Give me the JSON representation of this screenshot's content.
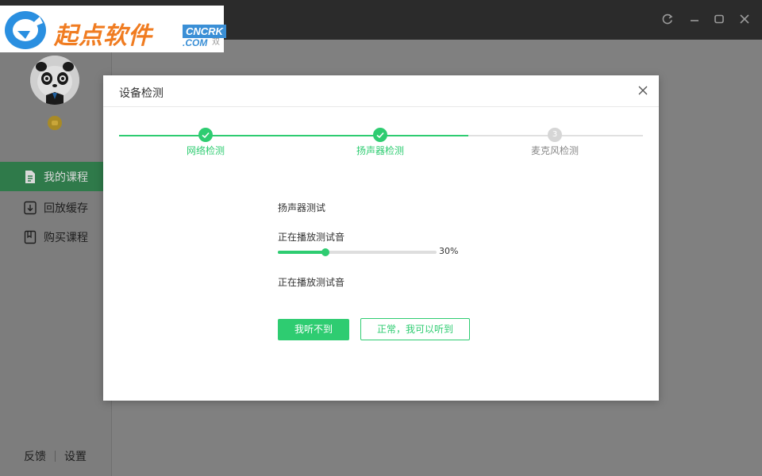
{
  "colors": {
    "accent": "#2ecc71",
    "titlebar": "#2b2b2b",
    "overlay": "#808080",
    "logo_orange": "#f07c21",
    "logo_blue": "#3a8fd6"
  },
  "logo": {
    "text": "起点软件",
    "badge_top": "CNCRK",
    "badge_bottom": ".COM",
    "badge_ext": "双"
  },
  "window_controls": {
    "refresh": "refresh-icon",
    "minimize": "minimize-icon",
    "maximize": "maximize-icon",
    "close": "close-icon"
  },
  "sidebar": {
    "items": [
      {
        "label": "我的课程",
        "icon": "document-icon",
        "active": true
      },
      {
        "label": "回放缓存",
        "icon": "download-icon",
        "active": false
      },
      {
        "label": "购买课程",
        "icon": "book-icon",
        "active": false
      }
    ],
    "footer": {
      "feedback": "反馈",
      "settings": "设置"
    }
  },
  "modal": {
    "title": "设备检测",
    "steps": [
      {
        "label": "网络检测",
        "state": "done"
      },
      {
        "label": "扬声器检测",
        "state": "done"
      },
      {
        "label": "麦克风检测",
        "state": "todo",
        "number": "3"
      }
    ],
    "section_title": "扬声器测试",
    "status_playing": "正在播放测试音",
    "progress": {
      "value": 0.3,
      "label": "30%"
    },
    "status_playing_2": "正在播放测试音",
    "btn_cant_hear": "我听不到",
    "btn_can_hear": "正常，我可以听到"
  }
}
